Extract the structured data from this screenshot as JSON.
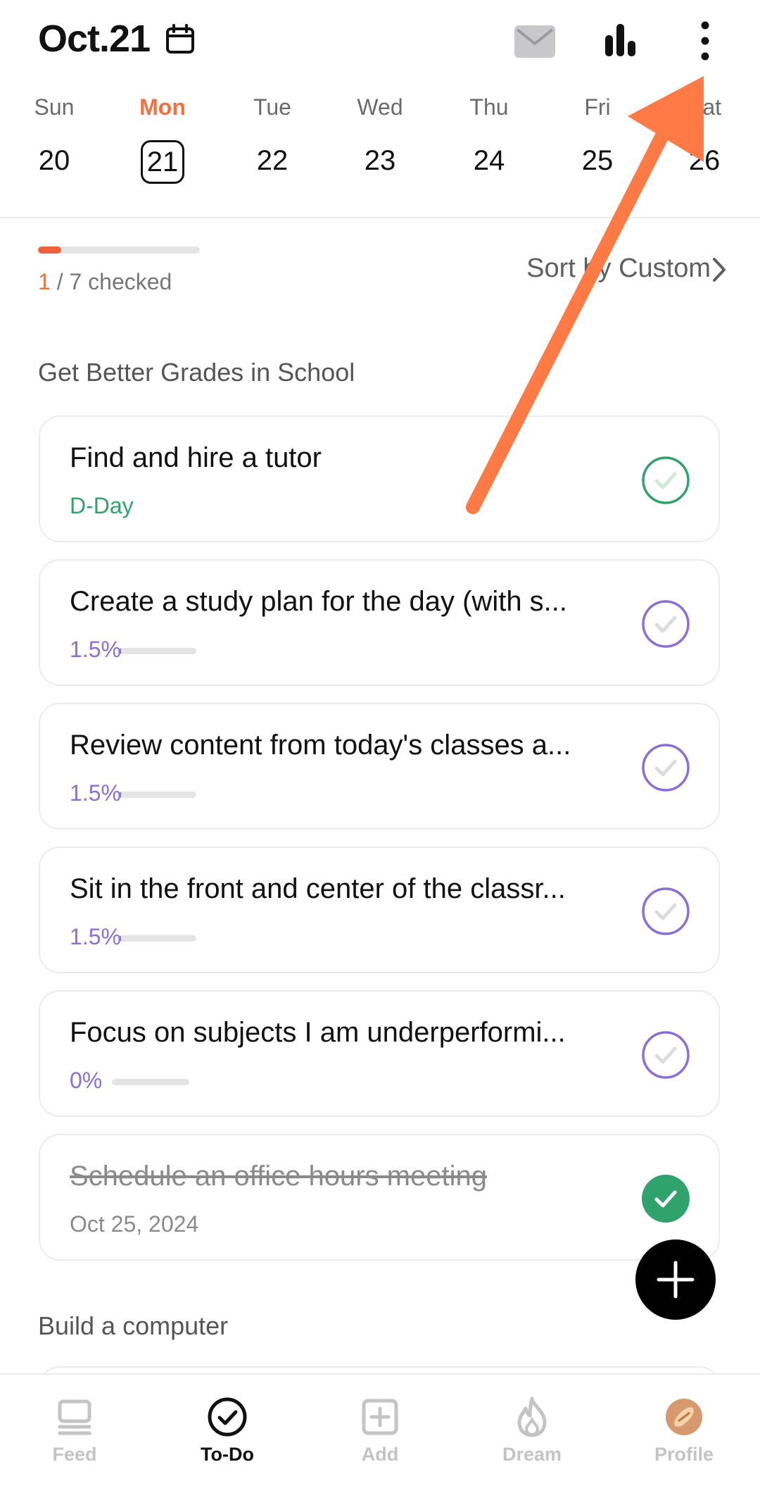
{
  "header": {
    "date_title": "Oct.21"
  },
  "week": {
    "days": [
      {
        "name": "Sun",
        "num": "20"
      },
      {
        "name": "Mon",
        "num": "21"
      },
      {
        "name": "Tue",
        "num": "22"
      },
      {
        "name": "Wed",
        "num": "23"
      },
      {
        "name": "Thu",
        "num": "24"
      },
      {
        "name": "Fri",
        "num": "25"
      },
      {
        "name": "Sat",
        "num": "26"
      }
    ],
    "selected_day": "21"
  },
  "progress": {
    "checked": "1",
    "total_text": " / 7 checked",
    "fraction": 0.143
  },
  "sort": {
    "label": "Sort by Custom"
  },
  "sections": [
    {
      "title": "Get Better Grades in School",
      "items": [
        {
          "title": "Find and hire a tutor",
          "sub": "D-Day",
          "status": "open"
        },
        {
          "title": "Create a study plan for the day (with s...",
          "pct": "1.5%",
          "progress": 0.015,
          "status": "open"
        },
        {
          "title": "Review content from today's classes a...",
          "pct": "1.5%",
          "progress": 0.015,
          "status": "open"
        },
        {
          "title": "Sit in the front and center of the classr...",
          "pct": "1.5%",
          "progress": 0.015,
          "status": "open"
        },
        {
          "title": "Focus on subjects I am underperformi...",
          "pct": "0%",
          "progress": 0.0,
          "status": "open"
        },
        {
          "title": "Schedule an office hours meeting",
          "sub": "Oct 25, 2024",
          "status": "done"
        }
      ]
    },
    {
      "title": "Build a computer"
    }
  ],
  "nav": {
    "items": [
      {
        "label": "Feed",
        "icon": "feed-icon"
      },
      {
        "label": "To-Do",
        "icon": "todo-check-icon"
      },
      {
        "label": "Add",
        "icon": "add-square-icon"
      },
      {
        "label": "Dream",
        "icon": "flame-icon"
      },
      {
        "label": "Profile",
        "icon": "avatar"
      }
    ],
    "active": "To-Do"
  },
  "colors": {
    "accent_orange": "#f07040",
    "green": "#2fa36b",
    "purple": "#8a6fd8",
    "annotation_arrow": "#ff7a45"
  }
}
